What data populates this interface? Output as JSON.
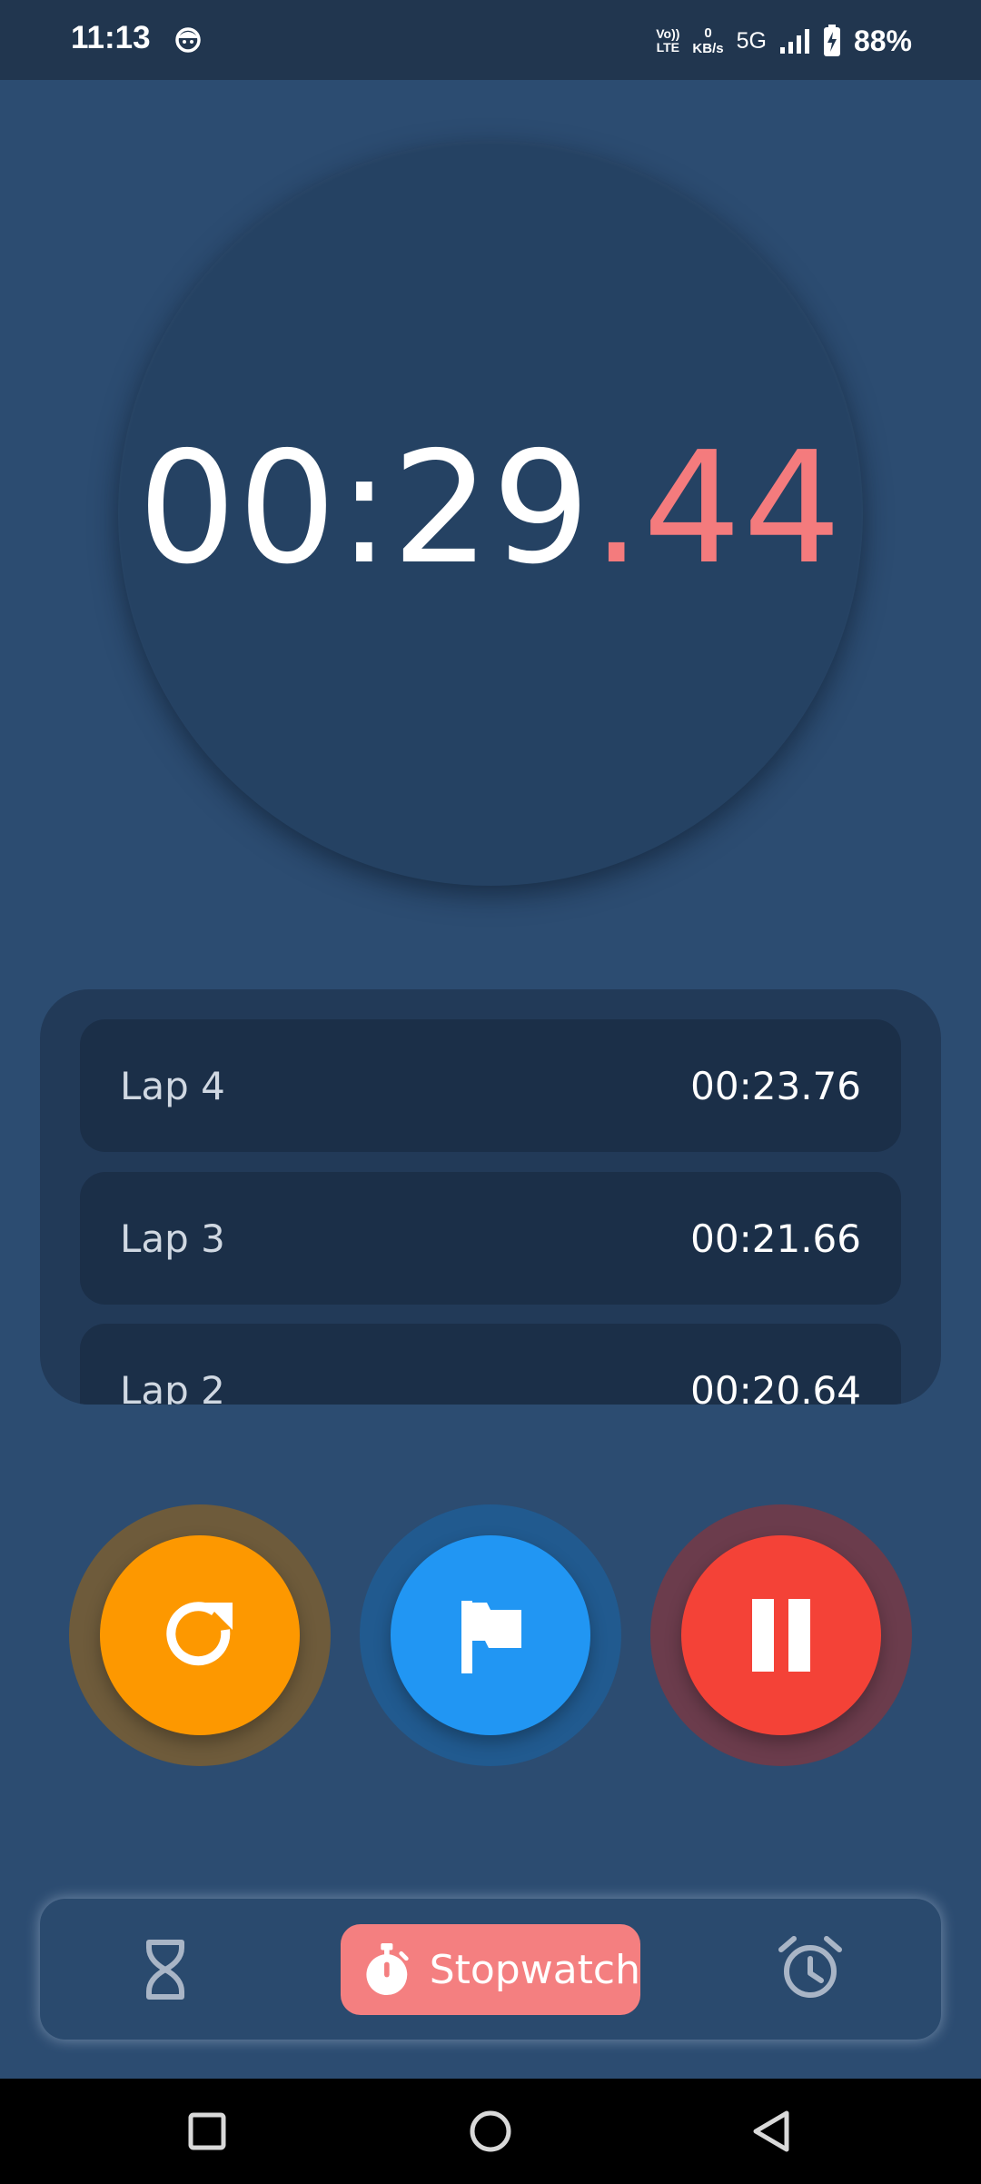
{
  "status_bar": {
    "time": "11:13",
    "volte_top": "Vo))",
    "volte_bottom": "LTE",
    "net_speed_value": "0",
    "net_speed_unit": "KB/s",
    "network": "5G",
    "battery": "88%",
    "icons": [
      "app-notification-icon",
      "signal-icon",
      "battery-charging-icon"
    ]
  },
  "stopwatch": {
    "time_main": "00:29",
    "time_separator": ".",
    "time_fraction": "44",
    "fraction_color": "#f47b7d"
  },
  "laps": [
    {
      "label": "Lap 4",
      "time": "00:23.76"
    },
    {
      "label": "Lap 3",
      "time": "00:21.66"
    },
    {
      "label": "Lap 2",
      "time": "00:20.64"
    }
  ],
  "controls": [
    {
      "name": "reset-button",
      "icon": "refresh-icon",
      "color": "#fd9800"
    },
    {
      "name": "lap-button",
      "icon": "flag-icon",
      "color": "#2196f3"
    },
    {
      "name": "pause-button",
      "icon": "pause-icon",
      "color": "#f44237"
    }
  ],
  "bottom_nav": {
    "items": [
      {
        "name": "timer",
        "icon": "hourglass-icon",
        "selected": false
      },
      {
        "name": "stopwatch",
        "icon": "stopwatch-icon",
        "selected": true,
        "label": "Stopwatch"
      },
      {
        "name": "alarm",
        "icon": "alarm-clock-icon",
        "selected": false
      }
    ],
    "accent_color": "#f47f80"
  },
  "system_nav": {
    "icons": [
      "recents-square-icon",
      "home-circle-icon",
      "back-triangle-icon"
    ]
  }
}
